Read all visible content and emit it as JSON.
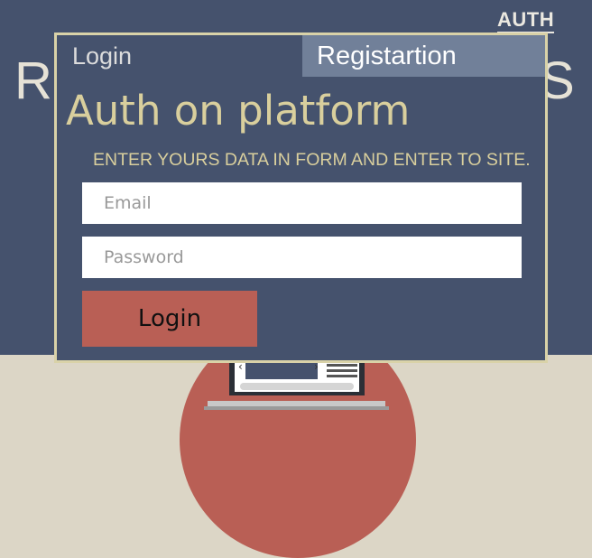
{
  "header": {
    "auth_link": "AUTH",
    "background_letters": [
      "R",
      "S"
    ]
  },
  "modal": {
    "tabs": {
      "login": "Login",
      "registration": "Registartion"
    },
    "title": "Auth on platform",
    "subtitle": "ENTER YOURS DATA IN FORM AND ENTER TO SITE.",
    "email": {
      "placeholder": "Email",
      "value": ""
    },
    "password": {
      "placeholder": "Password",
      "value": ""
    },
    "submit_label": "Login"
  },
  "colors": {
    "hero_background": "#45526d",
    "page_background": "#dcd6c6",
    "accent_red": "#b95f55",
    "modal_border": "#d9d2a8",
    "title_text": "#d9cf9d",
    "active_tab": "#718099"
  }
}
